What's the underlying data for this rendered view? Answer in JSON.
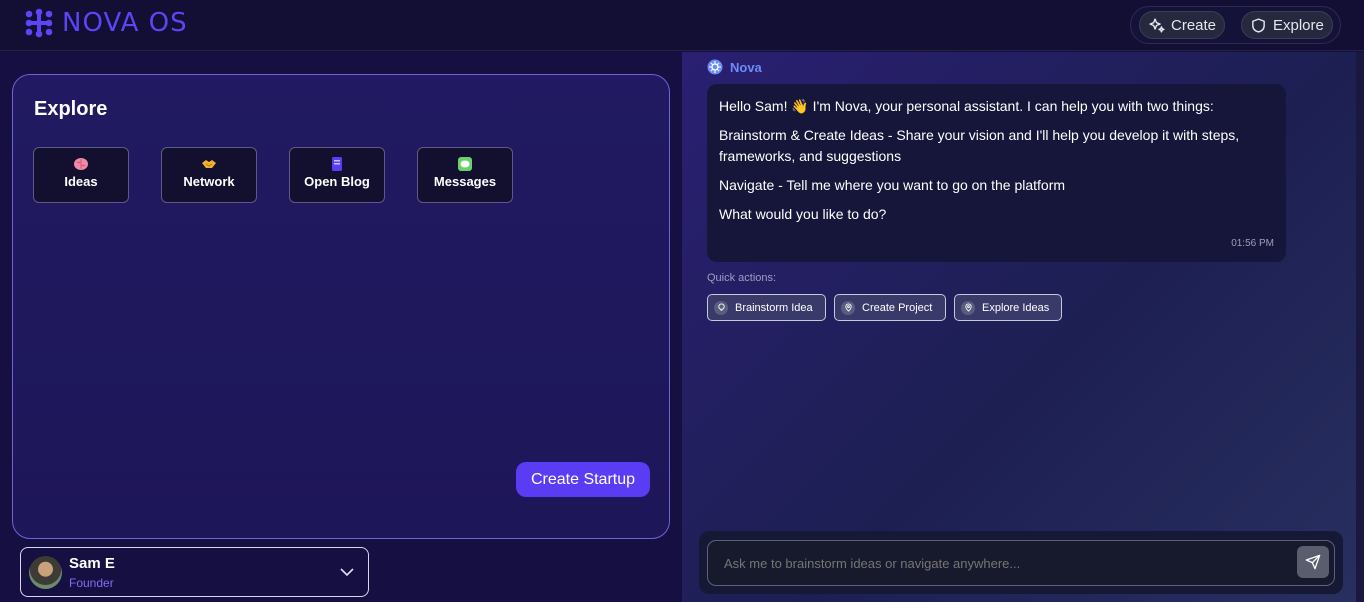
{
  "app": {
    "logo_text": "NOVA OS"
  },
  "top_nav": {
    "create_label": "Create",
    "explore_label": "Explore"
  },
  "explore": {
    "title": "Explore",
    "tiles": [
      {
        "label": "Ideas",
        "icon": "brain-icon"
      },
      {
        "label": "Network",
        "icon": "handshake-icon"
      },
      {
        "label": "Open Blog",
        "icon": "notebook-icon"
      },
      {
        "label": "Messages",
        "icon": "chat-icon"
      }
    ],
    "create_startup_label": "Create Startup"
  },
  "user": {
    "name": "Sam E",
    "role": "Founder"
  },
  "chat": {
    "assistant_name": "Nova",
    "message": {
      "lines": [
        "Hello Sam! 👋 I'm Nova, your personal assistant. I can help you with two things:",
        "Brainstorm & Create Ideas - Share your vision and I'll help you develop it with steps, frameworks, and suggestions",
        "Navigate - Tell me where you want to go on the platform",
        "What would you like to do?"
      ],
      "time": "01:56 PM"
    },
    "quick_actions_label": "Quick actions:",
    "quick_actions": [
      "Brainstorm Idea",
      "Create Project",
      "Explore Ideas"
    ],
    "input_placeholder": "Ask me to brainstorm ideas or navigate anywhere..."
  },
  "colors": {
    "accent": "#5b3cf5",
    "logo": "#5b45f5",
    "assistant_name": "#6c8cf7"
  }
}
